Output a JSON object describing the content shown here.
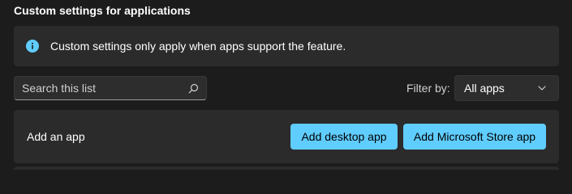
{
  "section": {
    "title": "Custom settings for applications"
  },
  "info_bar": {
    "icon": "info-icon",
    "text": "Custom settings only apply when apps support the feature."
  },
  "search": {
    "placeholder": "Search this list",
    "value": "",
    "icon": "search-icon"
  },
  "filter": {
    "label": "Filter by:",
    "selected": "All apps",
    "icon": "chevron-down-icon"
  },
  "add_app": {
    "label": "Add an app",
    "desktop_button": "Add desktop app",
    "store_button": "Add Microsoft Store app"
  },
  "colors": {
    "background": "#1c1c1c",
    "card": "#2b2b2b",
    "accent": "#60cdff",
    "text": "#ffffff",
    "secondary_text": "#cfcfcf"
  }
}
